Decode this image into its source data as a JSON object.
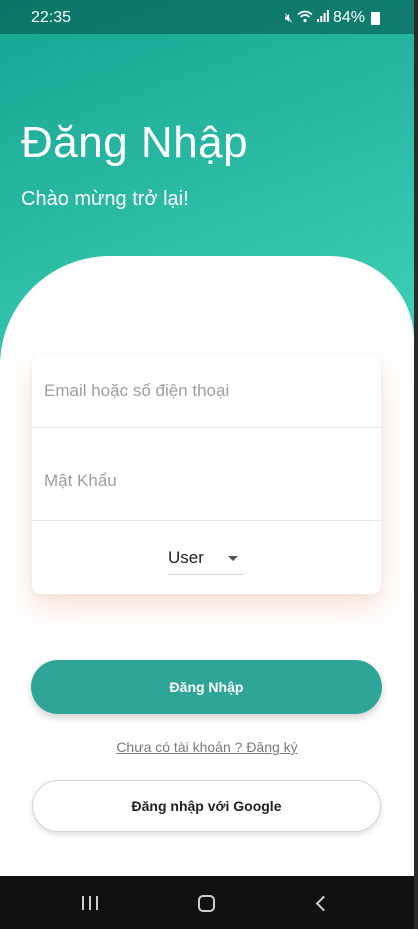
{
  "status_bar": {
    "time": "22:35",
    "battery": "84%",
    "icons": [
      "mute-icon",
      "wifi-icon",
      "signal-icon",
      "battery-icon"
    ]
  },
  "header": {
    "title": "Đăng Nhập",
    "subtitle": "Chào mừng trở lại!"
  },
  "form": {
    "email_placeholder": "Email hoặc số điện thoại",
    "password_placeholder": "Mật Khẩu",
    "role_value": "User"
  },
  "actions": {
    "login_label": "Đăng Nhập",
    "register_link": "Chưa có tài khoản ? Đăng ký",
    "google_label": "Đăng nhập với Google"
  },
  "nav_bar": {
    "icons": [
      "recent-apps-icon",
      "home-icon",
      "back-icon"
    ]
  },
  "colors": {
    "primary": "#2ea597",
    "gradient_start": "#15a493",
    "gradient_end": "#3fd3b8"
  }
}
